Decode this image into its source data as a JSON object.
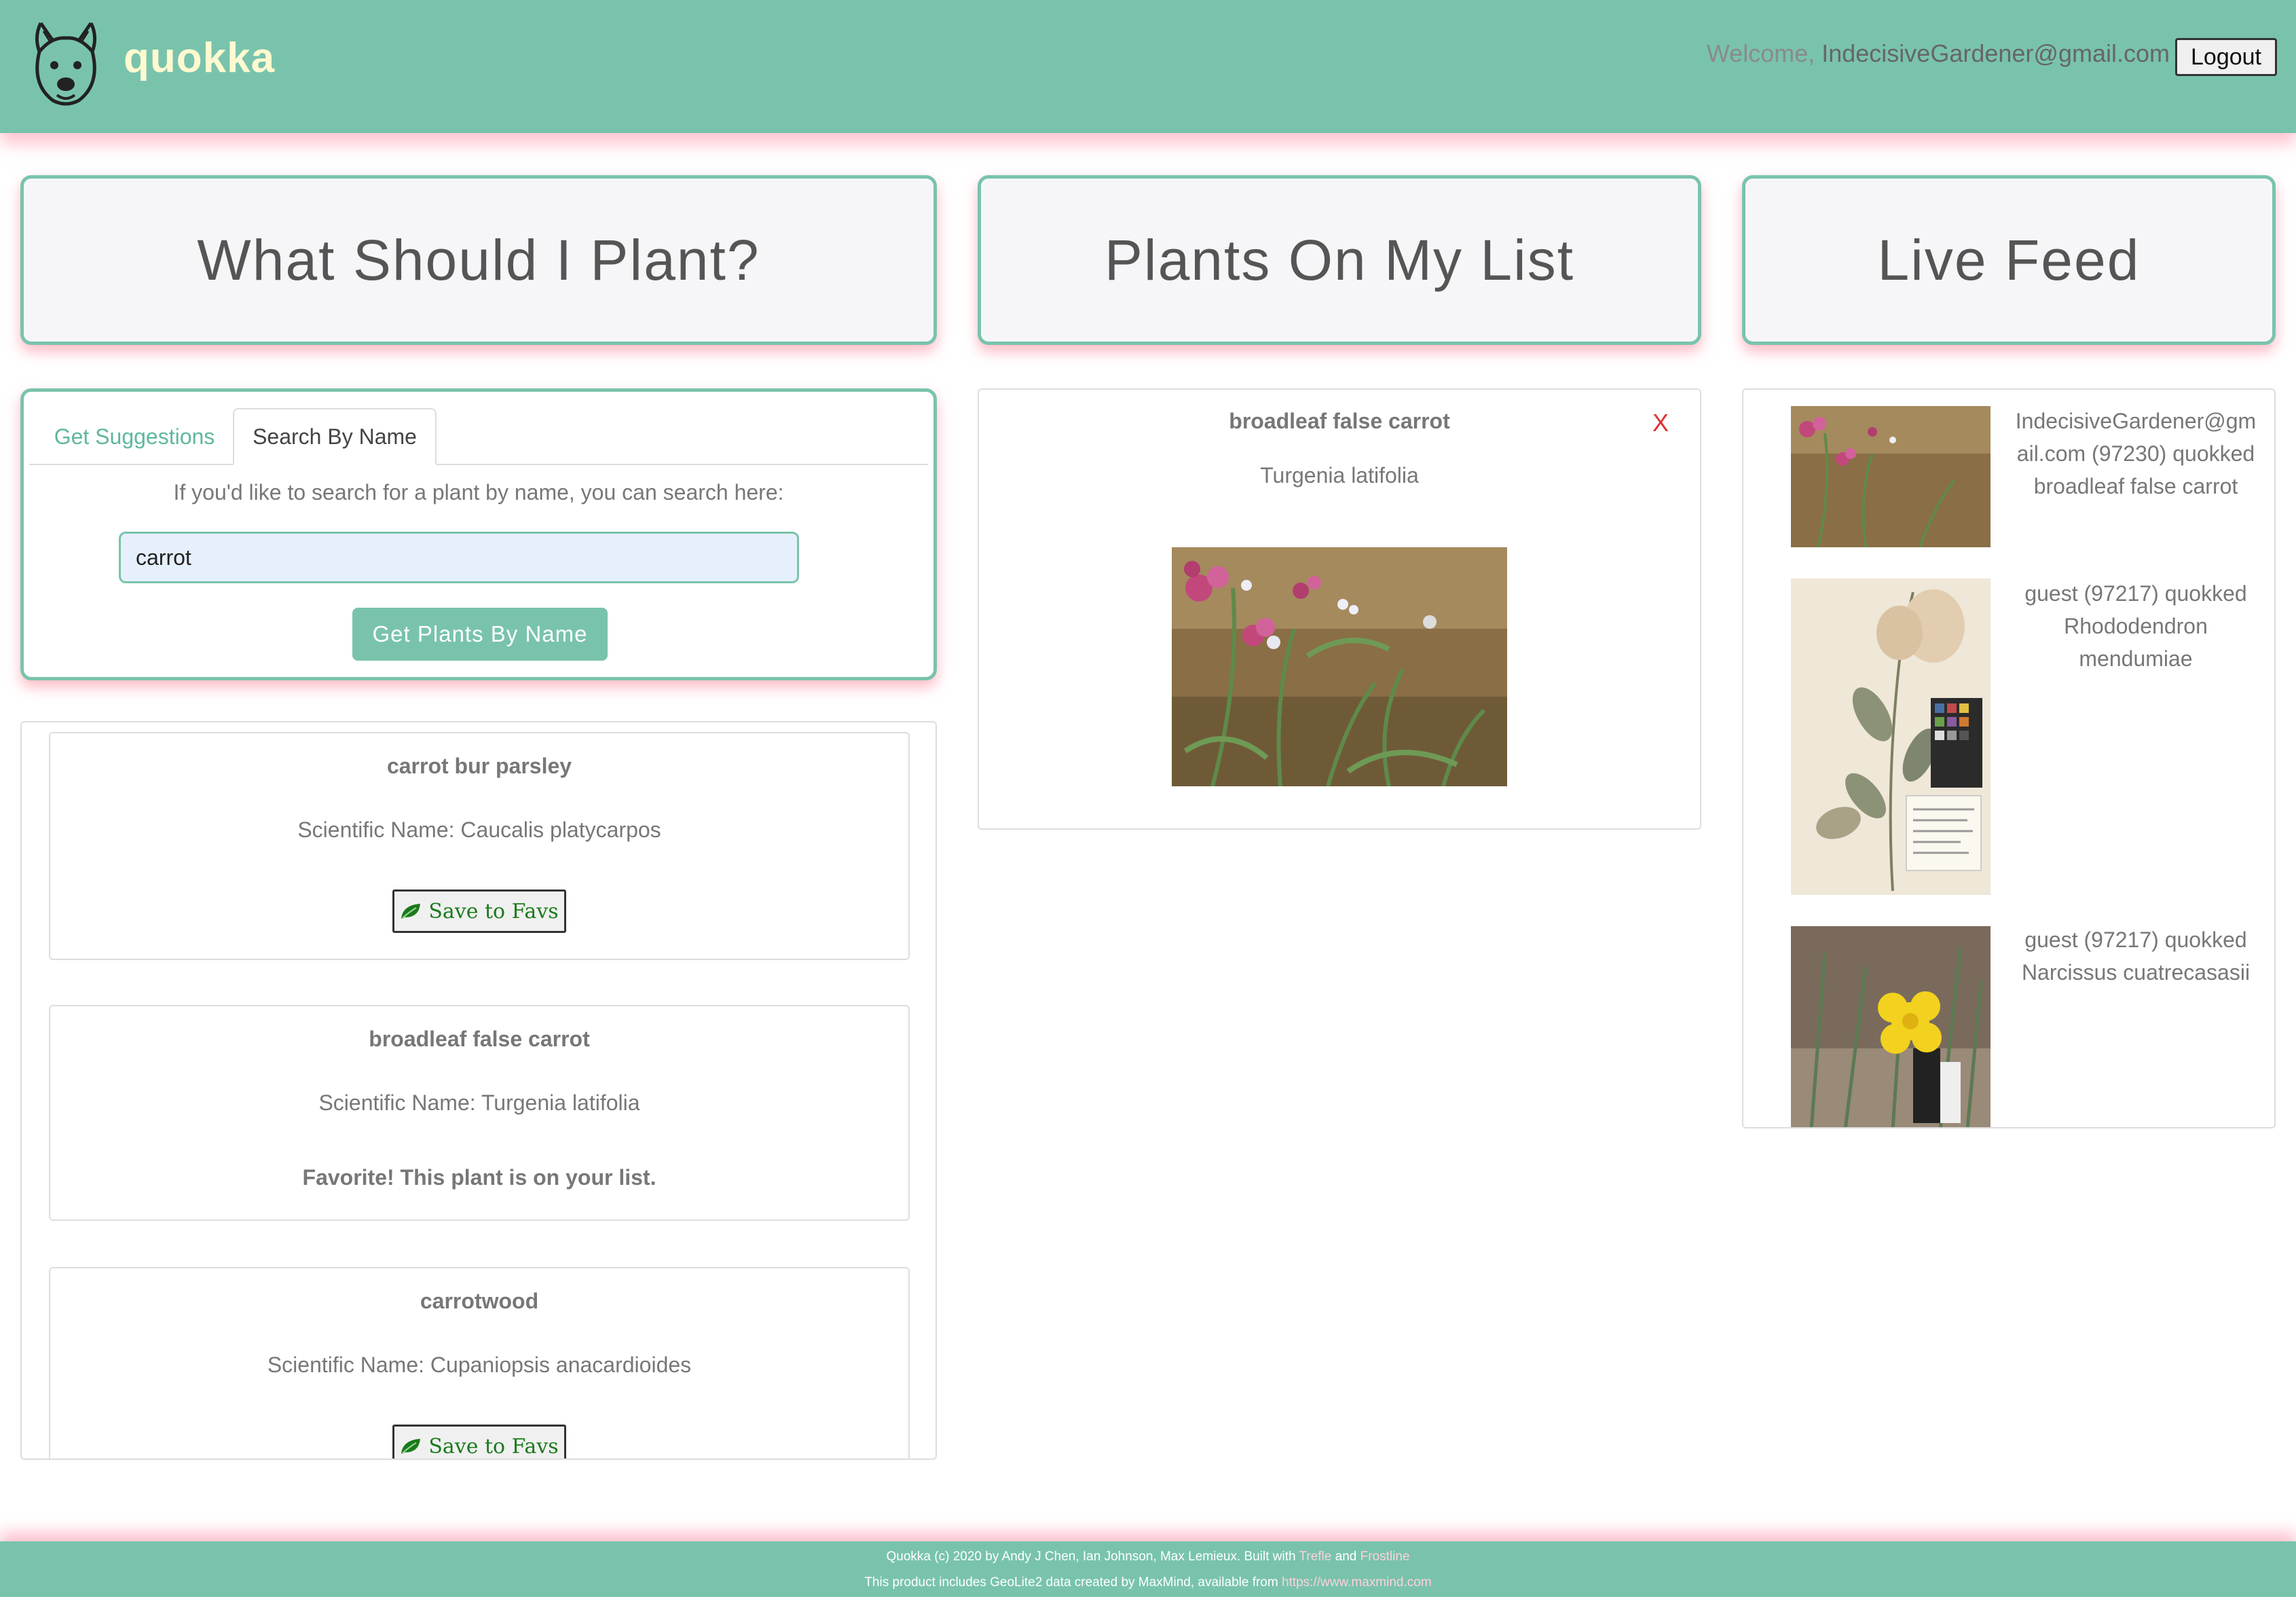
{
  "header": {
    "brand": "quokka",
    "welcome_prefix": "Welcome, ",
    "user_email": "IndecisiveGardener@gmail.com",
    "logout_label": "Logout"
  },
  "panels": {
    "suggest_title": "What Should I Plant?",
    "list_title": "Plants On My List",
    "feed_title": "Live Feed"
  },
  "search": {
    "tabs": [
      {
        "label": "Get Suggestions",
        "active": false
      },
      {
        "label": "Search By Name",
        "active": true
      }
    ],
    "prompt": "If you'd like to search for a plant by name, you can search here:",
    "input_value": "carrot",
    "button_label": "Get Plants By Name"
  },
  "results": [
    {
      "common_name": "carrot bur parsley",
      "scientific": "Scientific Name: Caucalis platycarpos",
      "action": "Save to Favs"
    },
    {
      "common_name": "broadleaf false carrot",
      "scientific": "Scientific Name: Turgenia latifolia",
      "favorite_msg": "Favorite! This plant is on your list."
    },
    {
      "common_name": "carrotwood",
      "scientific": "Scientific Name: Cupaniopsis anacardioides",
      "action": "Save to Favs"
    }
  ],
  "my_list": [
    {
      "common_name": "broadleaf false carrot",
      "scientific": "Turgenia latifolia",
      "remove": "X"
    }
  ],
  "feed": [
    {
      "text": "IndecisiveGardener@gmail.com (97230) quokked broadleaf false carrot"
    },
    {
      "text": "guest (97217) quokked Rhododendron mendumiae"
    },
    {
      "text": "guest (97217) quokked Narcissus cuatrecasasii"
    }
  ],
  "footer": {
    "line1_prefix": "Quokka (c) 2020 by Andy J Chen, Ian Johnson, Max Lemieux. Built with ",
    "link1": "Trefle",
    "and": " and ",
    "link2": "Frostline",
    "line2_prefix": "This product includes GeoLite2 data created by MaxMind, available from ",
    "link3": "https://www.maxmind.com"
  },
  "colors": {
    "brand_green": "#79c3ad",
    "shadow_pink": "#ff96aa",
    "remove_red": "#e03030",
    "fav_green": "#1a7a1a"
  },
  "icons": [
    "quokka-logo-icon",
    "leaf-icon"
  ]
}
